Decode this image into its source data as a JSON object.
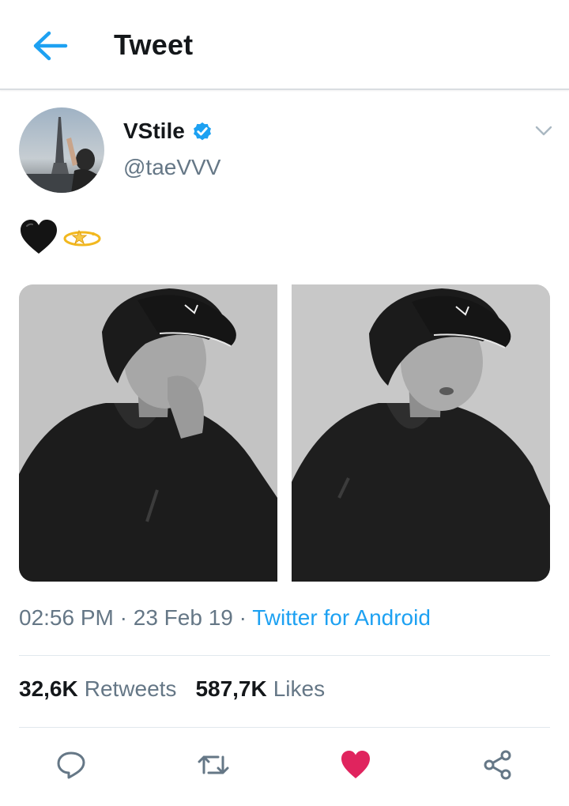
{
  "header": {
    "title": "Tweet"
  },
  "author": {
    "display_name": "VStile",
    "handle": "@taeVVV",
    "verified": true
  },
  "tweet": {
    "emoji": [
      "🖤",
      "💫"
    ]
  },
  "media": {
    "photo_count": 2
  },
  "meta": {
    "time": "02:56 PM",
    "separator": " · ",
    "date": "23 Feb 19",
    "source": "Twitter for Android"
  },
  "stats": {
    "retweets_count": "32,6K",
    "retweets_label": "Retweets",
    "likes_count": "587,7K",
    "likes_label": "Likes"
  },
  "actions": [
    "reply-icon",
    "retweet-icon",
    "like-icon",
    "share-icon"
  ],
  "colors": {
    "accent": "#1da1f2",
    "like": "#e0245e",
    "text": "#14171a",
    "secondary": "#657786"
  }
}
